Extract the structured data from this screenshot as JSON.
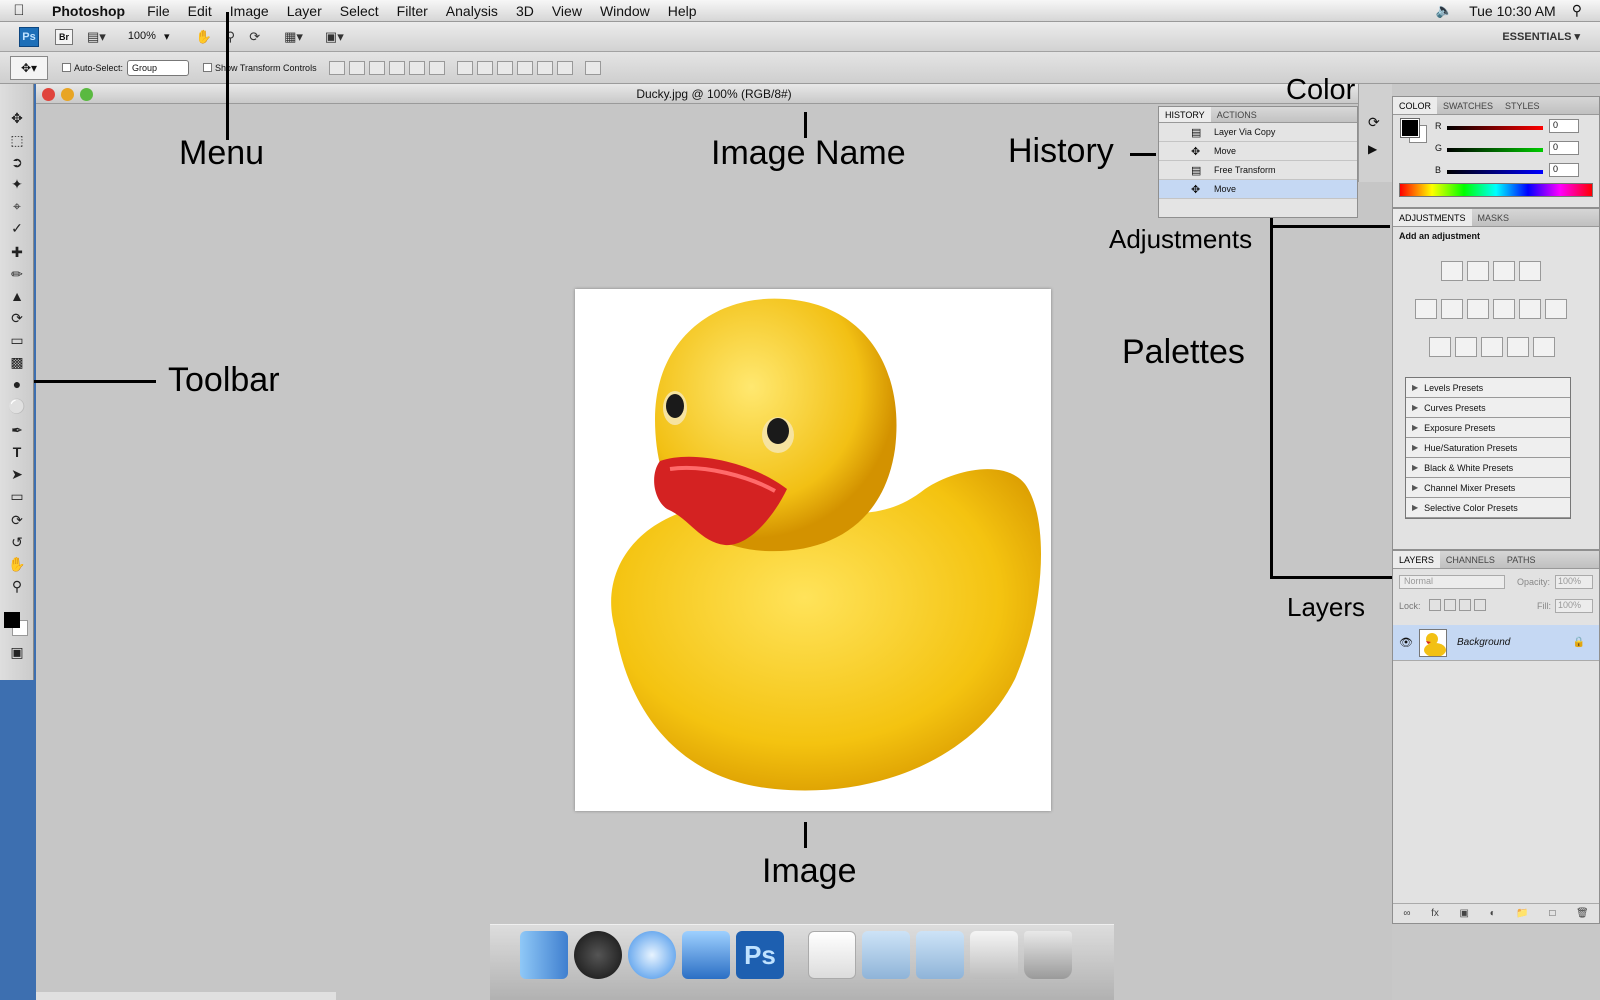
{
  "menubar": {
    "app_name": "Photoshop",
    "items": [
      "File",
      "Edit",
      "Image",
      "Layer",
      "Select",
      "Filter",
      "Analysis",
      "3D",
      "View",
      "Window",
      "Help"
    ],
    "clock": "Tue 10:30 AM",
    "icons": [
      "apple-icon",
      "volume-icon",
      "spotlight-icon"
    ]
  },
  "appbar": {
    "logo": "Ps",
    "bridge": "Br",
    "zoom": "100%",
    "workspace": "ESSENTIALS"
  },
  "options": {
    "auto_select_label": "Auto-Select:",
    "auto_select_value": "Group",
    "transform_label": "Show Transform Controls"
  },
  "document": {
    "title": "Ducky.jpg @ 100% (RGB/8#)"
  },
  "annotations": {
    "menu": "Menu",
    "image_name": "Image Name",
    "history": "History",
    "color": "Color",
    "adjustments": "Adjustments",
    "toolbar": "Toolbar",
    "palettes": "Palettes",
    "layers": "Layers",
    "image": "Image"
  },
  "history_panel": {
    "tabs": [
      "HISTORY",
      "ACTIONS"
    ],
    "rows": [
      "Layer Via Copy",
      "Move",
      "Free Transform",
      "Move"
    ]
  },
  "color_panel": {
    "tabs": [
      "COLOR",
      "SWATCHES",
      "STYLES"
    ],
    "channels": [
      {
        "label": "R",
        "value": "0"
      },
      {
        "label": "G",
        "value": "0"
      },
      {
        "label": "B",
        "value": "0"
      }
    ]
  },
  "adjustments_panel": {
    "tabs": [
      "ADJUSTMENTS",
      "MASKS"
    ],
    "heading": "Add an adjustment",
    "presets": [
      "Levels Presets",
      "Curves Presets",
      "Exposure Presets",
      "Hue/Saturation Presets",
      "Black & White Presets",
      "Channel Mixer Presets",
      "Selective Color Presets"
    ]
  },
  "layers_panel": {
    "tabs": [
      "LAYERS",
      "CHANNELS",
      "PATHS"
    ],
    "blend_mode": "Normal",
    "opacity_label": "Opacity:",
    "opacity_value": "100%",
    "lock_label": "Lock:",
    "fill_label": "Fill:",
    "fill_value": "100%",
    "layer_name": "Background"
  },
  "dock": {
    "apps": [
      "finder-icon",
      "dashboard-icon",
      "safari-icon",
      "word-icon",
      "photoshop-icon",
      "pdf-icon",
      "documents-folder-icon",
      "downloads-folder-icon",
      "preview-icon",
      "trash-icon"
    ]
  }
}
